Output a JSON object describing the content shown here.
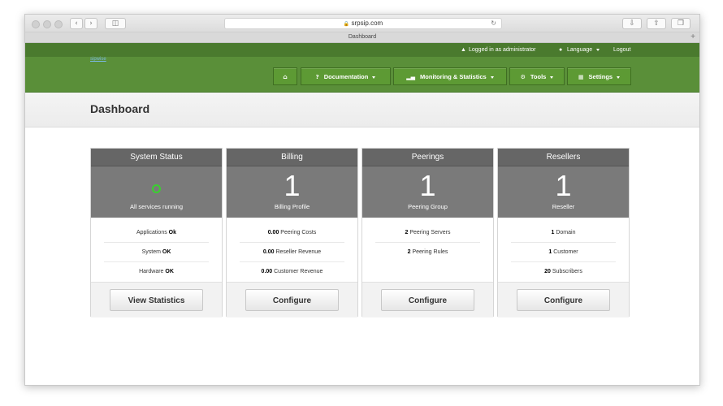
{
  "browser": {
    "url": "srpsip.com",
    "tab_title": "Dashboard"
  },
  "topbar": {
    "logged_in": "Logged in as administrator",
    "language": "Language",
    "logout": "Logout"
  },
  "menu": {
    "logo_text": "sipwise",
    "items": [
      {
        "label": "Documentation",
        "icon": "help-icon"
      },
      {
        "label": "Monitoring & Statistics",
        "icon": "bar-chart-icon"
      },
      {
        "label": "Tools",
        "icon": "gear-icon"
      },
      {
        "label": "Settings",
        "icon": "grid-icon"
      }
    ]
  },
  "page": {
    "title": "Dashboard"
  },
  "cards": [
    {
      "title": "System Status",
      "hero_sub": "All services running",
      "rows": [
        {
          "label": "Applications",
          "value": "Ok"
        },
        {
          "label": "System",
          "value": "OK"
        },
        {
          "label": "Hardware",
          "value": "OK"
        }
      ],
      "button": "View Statistics"
    },
    {
      "title": "Billing",
      "hero_value": "1",
      "hero_sub": "Billing Profile",
      "rows": [
        {
          "value": "0.00",
          "label": "Peering Costs"
        },
        {
          "value": "0.00",
          "label": "Reseller Revenue"
        },
        {
          "value": "0.00",
          "label": "Customer Revenue"
        }
      ],
      "button": "Configure"
    },
    {
      "title": "Peerings",
      "hero_value": "1",
      "hero_sub": "Peering Group",
      "rows": [
        {
          "value": "2",
          "label": "Peering Servers"
        },
        {
          "value": "2",
          "label": "Peering Rules"
        }
      ],
      "button": "Configure"
    },
    {
      "title": "Resellers",
      "hero_value": "1",
      "hero_sub": "Reseller",
      "rows": [
        {
          "value": "1",
          "label": "Domain"
        },
        {
          "value": "1",
          "label": "Customer"
        },
        {
          "value": "20",
          "label": "Subscribers"
        }
      ],
      "button": "Configure"
    }
  ],
  "colors": {
    "header_dark_green": "#4a7a2e",
    "header_green": "#5a8f39",
    "status_ok_green": "#39d12f"
  }
}
